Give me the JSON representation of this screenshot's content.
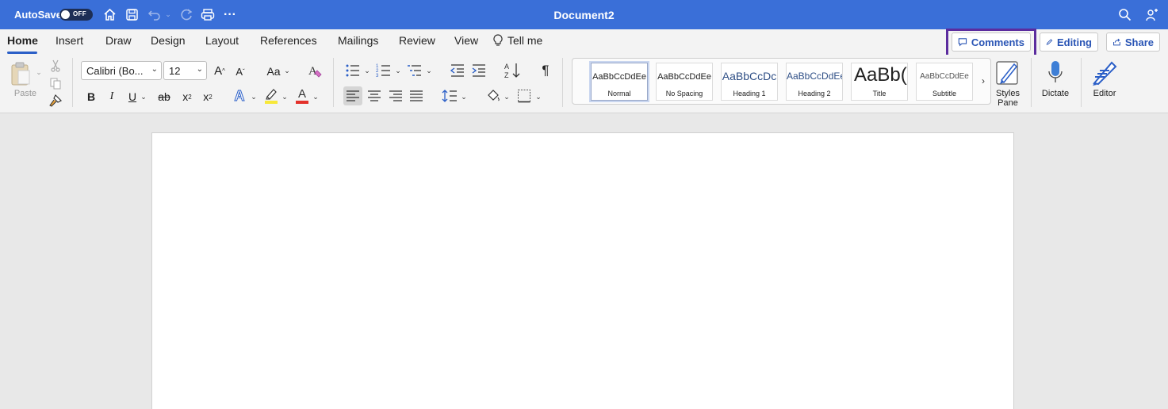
{
  "titlebar": {
    "autosave_label": "AutoSave",
    "autosave_toggle": "OFF",
    "document_title": "Document2",
    "icons": [
      "home-icon",
      "save-icon",
      "undo-icon",
      "redo-icon",
      "print-icon",
      "more-icon",
      "search-icon",
      "share-people-icon"
    ]
  },
  "tabs": [
    {
      "label": "Home",
      "active": true
    },
    {
      "label": "Insert"
    },
    {
      "label": "Draw"
    },
    {
      "label": "Design"
    },
    {
      "label": "Layout"
    },
    {
      "label": "References"
    },
    {
      "label": "Mailings"
    },
    {
      "label": "Review"
    },
    {
      "label": "View"
    },
    {
      "label": "Tell me"
    }
  ],
  "right_buttons": {
    "comments": "Comments",
    "editing": "Editing",
    "share": "Share"
  },
  "ribbon": {
    "paste_label": "Paste",
    "font_name": "Calibri (Bo...",
    "font_size": "12",
    "grow_font": "A",
    "shrink_font": "A",
    "change_case": "Aa",
    "bold": "B",
    "italic": "I",
    "underline": "U",
    "strikethrough": "ab",
    "subscript": "x",
    "superscript": "x",
    "text_effects": "A",
    "font_color": "A",
    "pilcrow": "¶",
    "styles_pane_label": "Styles Pane",
    "dictate_label": "Dictate",
    "editor_label": "Editor",
    "colors": {
      "accent": "#3a6fd8",
      "highlight": "#f7e83a",
      "font_color": "#e3312b",
      "highlight_box": "#5b2c9e"
    }
  },
  "styles": [
    {
      "sample": "AaBbCcDdEe",
      "name": "Normal",
      "selected": true
    },
    {
      "sample": "AaBbCcDdEe",
      "name": "No Spacing"
    },
    {
      "sample": "AaBbCcDc",
      "name": "Heading 1"
    },
    {
      "sample": "AaBbCcDdEe",
      "name": "Heading 2"
    },
    {
      "sample": "AaBb(",
      "name": "Title"
    },
    {
      "sample": "AaBbCcDdEe",
      "name": "Subtitle"
    }
  ]
}
